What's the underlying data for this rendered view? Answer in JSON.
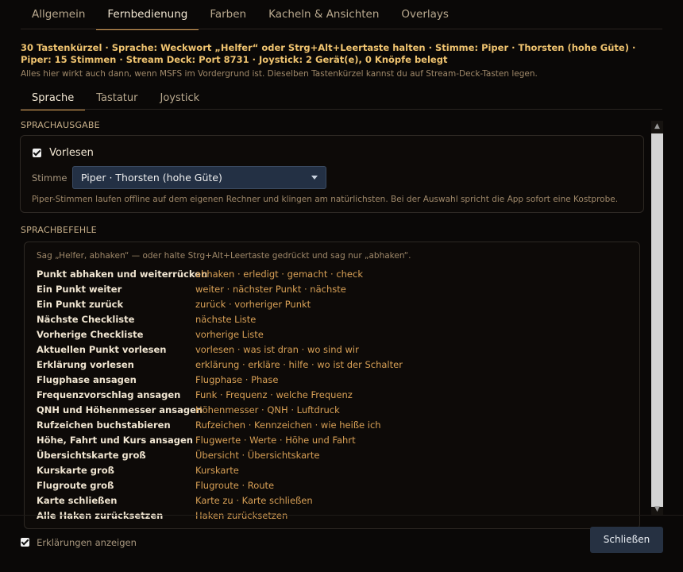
{
  "top_tabs": [
    "Allgemein",
    "Fernbedienung",
    "Farben",
    "Kacheln & Ansichten",
    "Overlays"
  ],
  "active_top_tab": 1,
  "summary": "30 Tastenkürzel · Sprache: Weckwort „Helfer“ oder Strg+Alt+Leertaste halten · Stimme: Piper · Thorsten (hohe Güte) · Piper: 15 Stimmen · Stream Deck: Port 8731 · Joystick: 2 Gerät(e), 0 Knöpfe belegt",
  "hint": "Alles hier wirkt auch dann, wenn MSFS im Vordergrund ist. Dieselben Tastenkürzel kannst du auf Stream-Deck-Tasten legen.",
  "sub_tabs": [
    "Sprache",
    "Tastatur",
    "Joystick"
  ],
  "active_sub_tab": 0,
  "speech_output": {
    "heading": "SPRACHAUSGABE",
    "read_aloud_label": "Vorlesen",
    "read_aloud_checked": true,
    "voice_label": "Stimme",
    "voice_value": "Piper · Thorsten (hohe Güte)",
    "note": "Piper-Stimmen laufen offline auf dem eigenen Rechner und klingen am natürlichsten. Bei der Auswahl spricht die App sofort eine Kostprobe."
  },
  "voice_commands": {
    "heading": "SPRACHBEFEHLE",
    "intro": "Sag „Helfer, abhaken“ — oder halte Strg+Alt+Leertaste gedrückt und sag nur „abhaken“.",
    "rows": [
      {
        "command": "Punkt abhaken und weiterrücken",
        "phrases": "abhaken · erledigt · gemacht · check"
      },
      {
        "command": "Ein Punkt weiter",
        "phrases": "weiter · nächster Punkt · nächste"
      },
      {
        "command": "Ein Punkt zurück",
        "phrases": "zurück · vorheriger Punkt"
      },
      {
        "command": "Nächste Checkliste",
        "phrases": "nächste Liste"
      },
      {
        "command": "Vorherige Checkliste",
        "phrases": "vorherige Liste"
      },
      {
        "command": "Aktuellen Punkt vorlesen",
        "phrases": "vorlesen · was ist dran · wo sind wir"
      },
      {
        "command": "Erklärung vorlesen",
        "phrases": "erklärung · erkläre · hilfe · wo ist der Schalter"
      },
      {
        "command": "Flugphase ansagen",
        "phrases": "Flugphase · Phase"
      },
      {
        "command": "Frequenzvorschlag ansagen",
        "phrases": "Funk · Frequenz · welche Frequenz"
      },
      {
        "command": "QNH und Höhenmesser ansagen",
        "phrases": "Höhenmesser · QNH · Luftdruck"
      },
      {
        "command": "Rufzeichen buchstabieren",
        "phrases": "Rufzeichen · Kennzeichen · wie heiße ich"
      },
      {
        "command": "Höhe, Fahrt und Kurs ansagen",
        "phrases": "Flugwerte · Werte · Höhe und Fahrt"
      },
      {
        "command": "Übersichtskarte groß",
        "phrases": "Übersicht · Übersichtskarte"
      },
      {
        "command": "Kurskarte groß",
        "phrases": "Kurskarte"
      },
      {
        "command": "Flugroute groß",
        "phrases": "Flugroute · Route"
      },
      {
        "command": "Karte schließen",
        "phrases": "Karte zu · Karte schließen"
      },
      {
        "command": "Alle Haken zurücksetzen",
        "phrases": "Haken zurücksetzen"
      }
    ]
  },
  "footer": {
    "show_explanations_label": "Erklärungen anzeigen",
    "show_explanations_checked": true,
    "close_label": "Schließen"
  },
  "colors": {
    "accent": "#d8a056",
    "summary": "#f0c470",
    "button": "#263142",
    "select": "#233044"
  }
}
